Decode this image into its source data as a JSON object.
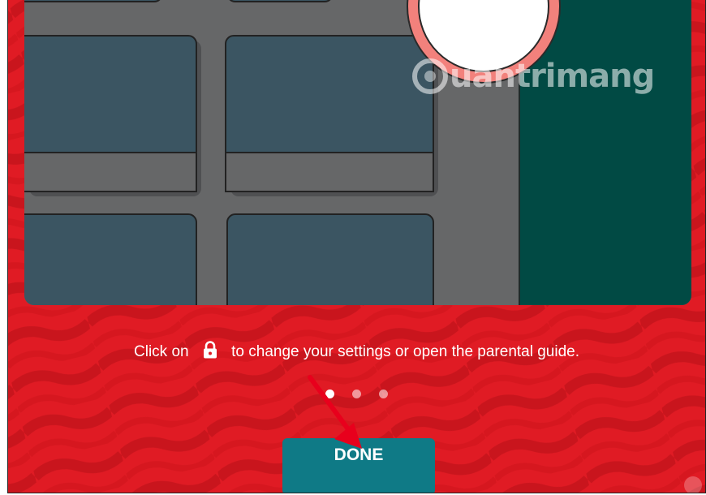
{
  "onboarding": {
    "caption_before": "Click on",
    "caption_after": "to change your settings or open the parental guide.",
    "lock_icon": "lock-icon",
    "pagination": {
      "total": 3,
      "active": 1
    },
    "done_label": "DONE"
  },
  "watermark": {
    "text": "uantrimang"
  },
  "colors": {
    "background": "#e01b24",
    "button": "#0f7a86",
    "illustration_panel": "#014a44",
    "illustration_tiles": "#3b5562"
  }
}
